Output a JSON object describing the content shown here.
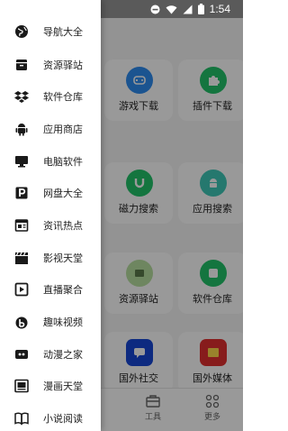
{
  "status_bar": {
    "time": "1:54"
  },
  "drawer": {
    "items": [
      {
        "label": "导航大全",
        "icon": "globe-icon"
      },
      {
        "label": "资源驿站",
        "icon": "archive-icon"
      },
      {
        "label": "软件仓库",
        "icon": "dropbox-icon"
      },
      {
        "label": "应用商店",
        "icon": "android-icon"
      },
      {
        "label": "电脑软件",
        "icon": "monitor-icon"
      },
      {
        "label": "网盘大全",
        "icon": "parking-icon"
      },
      {
        "label": "资讯热点",
        "icon": "newspaper-icon"
      },
      {
        "label": "影视天堂",
        "icon": "clapperboard-icon"
      },
      {
        "label": "直播聚合",
        "icon": "play-square-icon"
      },
      {
        "label": "趣味视频",
        "icon": "bilibili-icon"
      },
      {
        "label": "动漫之家",
        "icon": "anime-icon"
      },
      {
        "label": "漫画天堂",
        "icon": "comic-icon"
      },
      {
        "label": "小说阅读",
        "icon": "book-icon"
      }
    ]
  },
  "grid": {
    "cards": [
      {
        "label": "游戏下载",
        "color": "#2e8cf0",
        "icon": "gamepad-icon"
      },
      {
        "label": "插件下载",
        "color": "#22c36a",
        "icon": "puzzle-icon"
      },
      {
        "label": "磁力搜索",
        "color": "#22c36a",
        "icon": "magnet-icon"
      },
      {
        "label": "应用搜索",
        "color": "#3fc8b8",
        "icon": "android-icon"
      },
      {
        "label": "资源驿站",
        "color": "#b8dfa0",
        "icon": "resource-icon"
      },
      {
        "label": "软件仓库",
        "color": "#22c36a",
        "icon": "package-icon"
      },
      {
        "label": "国外社交",
        "color": "#1646d6",
        "icon": "chat-icon"
      },
      {
        "label": "国外媒体",
        "color": "#e23030",
        "icon": "media-icon"
      }
    ]
  },
  "tabbar": {
    "tabs": [
      {
        "label": "工具",
        "icon": "toolbox-icon"
      },
      {
        "label": "更多",
        "icon": "grid-icon"
      }
    ]
  },
  "colors": {
    "scrim": "#000000",
    "drawer_bg": "#ffffff",
    "icon": "#1a1a1a"
  }
}
